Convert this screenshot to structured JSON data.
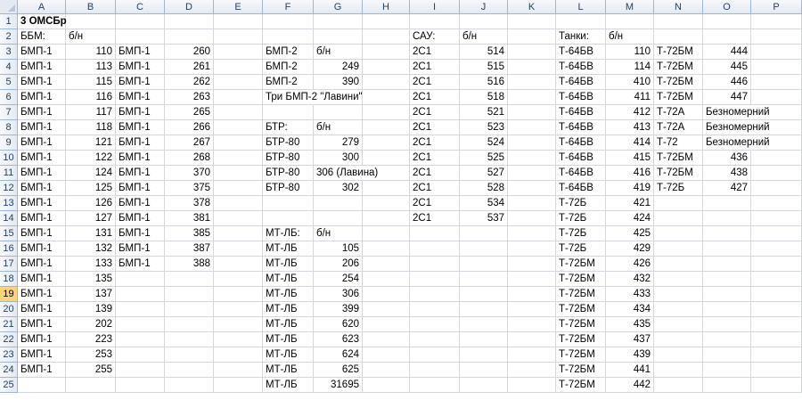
{
  "sheet": {
    "columns": [
      "A",
      "B",
      "C",
      "D",
      "E",
      "F",
      "G",
      "H",
      "I",
      "J",
      "K",
      "L",
      "M",
      "N",
      "O",
      "P"
    ],
    "rows": [
      "1",
      "2",
      "3",
      "4",
      "5",
      "6",
      "7",
      "8",
      "9",
      "10",
      "11",
      "12",
      "13",
      "14",
      "15",
      "16",
      "17",
      "18",
      "19",
      "20",
      "21",
      "22",
      "23",
      "24",
      "25"
    ],
    "selected_row": "19",
    "cells": [
      {
        "r": 1,
        "c": "A",
        "v": "3 ОМСБр",
        "bold": true
      },
      {
        "r": 2,
        "c": "A",
        "v": "ББМ:"
      },
      {
        "r": 2,
        "c": "B",
        "v": "б/н"
      },
      {
        "r": 2,
        "c": "I",
        "v": "САУ:"
      },
      {
        "r": 2,
        "c": "J",
        "v": "б/н"
      },
      {
        "r": 2,
        "c": "L",
        "v": "Танки:"
      },
      {
        "r": 2,
        "c": "M",
        "v": "б/н"
      },
      {
        "r": 3,
        "c": "A",
        "v": "БМП-1"
      },
      {
        "r": 3,
        "c": "B",
        "v": "110",
        "num": true
      },
      {
        "r": 3,
        "c": "C",
        "v": "БМП-1"
      },
      {
        "r": 3,
        "c": "D",
        "v": "260",
        "num": true
      },
      {
        "r": 3,
        "c": "F",
        "v": "БМП-2"
      },
      {
        "r": 3,
        "c": "G",
        "v": "б/н"
      },
      {
        "r": 3,
        "c": "I",
        "v": "2С1"
      },
      {
        "r": 3,
        "c": "J",
        "v": "514",
        "num": true
      },
      {
        "r": 3,
        "c": "L",
        "v": "Т-64БВ"
      },
      {
        "r": 3,
        "c": "M",
        "v": "110",
        "num": true
      },
      {
        "r": 3,
        "c": "N",
        "v": "Т-72БМ"
      },
      {
        "r": 3,
        "c": "O",
        "v": "444",
        "num": true
      },
      {
        "r": 4,
        "c": "A",
        "v": "БМП-1"
      },
      {
        "r": 4,
        "c": "B",
        "v": "113",
        "num": true
      },
      {
        "r": 4,
        "c": "C",
        "v": "БМП-1"
      },
      {
        "r": 4,
        "c": "D",
        "v": "261",
        "num": true
      },
      {
        "r": 4,
        "c": "F",
        "v": "БМП-2"
      },
      {
        "r": 4,
        "c": "G",
        "v": "249",
        "num": true
      },
      {
        "r": 4,
        "c": "I",
        "v": "2С1"
      },
      {
        "r": 4,
        "c": "J",
        "v": "515",
        "num": true
      },
      {
        "r": 4,
        "c": "L",
        "v": "Т-64БВ"
      },
      {
        "r": 4,
        "c": "M",
        "v": "114",
        "num": true
      },
      {
        "r": 4,
        "c": "N",
        "v": "Т-72БМ"
      },
      {
        "r": 4,
        "c": "O",
        "v": "445",
        "num": true
      },
      {
        "r": 5,
        "c": "A",
        "v": "БМП-1"
      },
      {
        "r": 5,
        "c": "B",
        "v": "115",
        "num": true
      },
      {
        "r": 5,
        "c": "C",
        "v": "БМП-1"
      },
      {
        "r": 5,
        "c": "D",
        "v": "262",
        "num": true
      },
      {
        "r": 5,
        "c": "F",
        "v": "БМП-2"
      },
      {
        "r": 5,
        "c": "G",
        "v": "390",
        "num": true
      },
      {
        "r": 5,
        "c": "I",
        "v": "2С1"
      },
      {
        "r": 5,
        "c": "J",
        "v": "516",
        "num": true
      },
      {
        "r": 5,
        "c": "L",
        "v": "Т-64БВ"
      },
      {
        "r": 5,
        "c": "M",
        "v": "410",
        "num": true
      },
      {
        "r": 5,
        "c": "N",
        "v": "Т-72БМ"
      },
      {
        "r": 5,
        "c": "O",
        "v": "446",
        "num": true
      },
      {
        "r": 6,
        "c": "A",
        "v": "БМП-1"
      },
      {
        "r": 6,
        "c": "B",
        "v": "116",
        "num": true
      },
      {
        "r": 6,
        "c": "C",
        "v": "БМП-1"
      },
      {
        "r": 6,
        "c": "D",
        "v": "263",
        "num": true
      },
      {
        "r": 6,
        "c": "F",
        "v": "Три БМП-2 \"Лавини\"",
        "over": true
      },
      {
        "r": 6,
        "c": "I",
        "v": "2С1"
      },
      {
        "r": 6,
        "c": "J",
        "v": "518",
        "num": true
      },
      {
        "r": 6,
        "c": "L",
        "v": "Т-64БВ"
      },
      {
        "r": 6,
        "c": "M",
        "v": "411",
        "num": true
      },
      {
        "r": 6,
        "c": "N",
        "v": "Т-72БМ"
      },
      {
        "r": 6,
        "c": "O",
        "v": "447",
        "num": true
      },
      {
        "r": 7,
        "c": "A",
        "v": "БМП-1"
      },
      {
        "r": 7,
        "c": "B",
        "v": "117",
        "num": true
      },
      {
        "r": 7,
        "c": "C",
        "v": "БМП-1"
      },
      {
        "r": 7,
        "c": "D",
        "v": "265",
        "num": true
      },
      {
        "r": 7,
        "c": "I",
        "v": "2С1"
      },
      {
        "r": 7,
        "c": "J",
        "v": "521",
        "num": true
      },
      {
        "r": 7,
        "c": "L",
        "v": "Т-64БВ"
      },
      {
        "r": 7,
        "c": "M",
        "v": "412",
        "num": true
      },
      {
        "r": 7,
        "c": "N",
        "v": "Т-72А"
      },
      {
        "r": 7,
        "c": "O",
        "v": "Безномерний",
        "over": true
      },
      {
        "r": 8,
        "c": "A",
        "v": "БМП-1"
      },
      {
        "r": 8,
        "c": "B",
        "v": "118",
        "num": true
      },
      {
        "r": 8,
        "c": "C",
        "v": "БМП-1"
      },
      {
        "r": 8,
        "c": "D",
        "v": "266",
        "num": true
      },
      {
        "r": 8,
        "c": "F",
        "v": "БТР:"
      },
      {
        "r": 8,
        "c": "G",
        "v": "б/н"
      },
      {
        "r": 8,
        "c": "I",
        "v": "2С1"
      },
      {
        "r": 8,
        "c": "J",
        "v": "523",
        "num": true
      },
      {
        "r": 8,
        "c": "L",
        "v": "Т-64БВ"
      },
      {
        "r": 8,
        "c": "M",
        "v": "413",
        "num": true
      },
      {
        "r": 8,
        "c": "N",
        "v": "Т-72А"
      },
      {
        "r": 8,
        "c": "O",
        "v": "Безномерний",
        "over": true
      },
      {
        "r": 9,
        "c": "A",
        "v": "БМП-1"
      },
      {
        "r": 9,
        "c": "B",
        "v": "121",
        "num": true
      },
      {
        "r": 9,
        "c": "C",
        "v": "БМП-1"
      },
      {
        "r": 9,
        "c": "D",
        "v": "267",
        "num": true
      },
      {
        "r": 9,
        "c": "F",
        "v": "БТР-80"
      },
      {
        "r": 9,
        "c": "G",
        "v": "279",
        "num": true
      },
      {
        "r": 9,
        "c": "I",
        "v": "2С1"
      },
      {
        "r": 9,
        "c": "J",
        "v": "524",
        "num": true
      },
      {
        "r": 9,
        "c": "L",
        "v": "Т-64БВ"
      },
      {
        "r": 9,
        "c": "M",
        "v": "414",
        "num": true
      },
      {
        "r": 9,
        "c": "N",
        "v": "Т-72"
      },
      {
        "r": 9,
        "c": "O",
        "v": "Безномерний",
        "over": true
      },
      {
        "r": 10,
        "c": "A",
        "v": "БМП-1"
      },
      {
        "r": 10,
        "c": "B",
        "v": "122",
        "num": true
      },
      {
        "r": 10,
        "c": "C",
        "v": "БМП-1"
      },
      {
        "r": 10,
        "c": "D",
        "v": "268",
        "num": true
      },
      {
        "r": 10,
        "c": "F",
        "v": "БТР-80"
      },
      {
        "r": 10,
        "c": "G",
        "v": "300",
        "num": true
      },
      {
        "r": 10,
        "c": "I",
        "v": "2С1"
      },
      {
        "r": 10,
        "c": "J",
        "v": "525",
        "num": true
      },
      {
        "r": 10,
        "c": "L",
        "v": "Т-64БВ"
      },
      {
        "r": 10,
        "c": "M",
        "v": "415",
        "num": true
      },
      {
        "r": 10,
        "c": "N",
        "v": "Т-72БМ"
      },
      {
        "r": 10,
        "c": "O",
        "v": "436",
        "num": true
      },
      {
        "r": 11,
        "c": "A",
        "v": "БМП-1"
      },
      {
        "r": 11,
        "c": "B",
        "v": "124",
        "num": true
      },
      {
        "r": 11,
        "c": "C",
        "v": "БМП-1"
      },
      {
        "r": 11,
        "c": "D",
        "v": "370",
        "num": true
      },
      {
        "r": 11,
        "c": "F",
        "v": "БТР-80"
      },
      {
        "r": 11,
        "c": "G",
        "v": "306 (Лавина)",
        "over": true
      },
      {
        "r": 11,
        "c": "I",
        "v": "2С1"
      },
      {
        "r": 11,
        "c": "J",
        "v": "527",
        "num": true
      },
      {
        "r": 11,
        "c": "L",
        "v": "Т-64БВ"
      },
      {
        "r": 11,
        "c": "M",
        "v": "416",
        "num": true
      },
      {
        "r": 11,
        "c": "N",
        "v": "Т-72БМ"
      },
      {
        "r": 11,
        "c": "O",
        "v": "438",
        "num": true
      },
      {
        "r": 12,
        "c": "A",
        "v": "БМП-1"
      },
      {
        "r": 12,
        "c": "B",
        "v": "125",
        "num": true
      },
      {
        "r": 12,
        "c": "C",
        "v": "БМП-1"
      },
      {
        "r": 12,
        "c": "D",
        "v": "375",
        "num": true
      },
      {
        "r": 12,
        "c": "F",
        "v": "БТР-80"
      },
      {
        "r": 12,
        "c": "G",
        "v": "302",
        "num": true
      },
      {
        "r": 12,
        "c": "I",
        "v": "2С1"
      },
      {
        "r": 12,
        "c": "J",
        "v": "528",
        "num": true
      },
      {
        "r": 12,
        "c": "L",
        "v": "Т-64БВ"
      },
      {
        "r": 12,
        "c": "M",
        "v": "419",
        "num": true
      },
      {
        "r": 12,
        "c": "N",
        "v": "Т-72Б"
      },
      {
        "r": 12,
        "c": "O",
        "v": "427",
        "num": true
      },
      {
        "r": 13,
        "c": "A",
        "v": "БМП-1"
      },
      {
        "r": 13,
        "c": "B",
        "v": "126",
        "num": true
      },
      {
        "r": 13,
        "c": "C",
        "v": "БМП-1"
      },
      {
        "r": 13,
        "c": "D",
        "v": "378",
        "num": true
      },
      {
        "r": 13,
        "c": "I",
        "v": "2С1"
      },
      {
        "r": 13,
        "c": "J",
        "v": "534",
        "num": true
      },
      {
        "r": 13,
        "c": "L",
        "v": "Т-72Б"
      },
      {
        "r": 13,
        "c": "M",
        "v": "421",
        "num": true
      },
      {
        "r": 14,
        "c": "A",
        "v": "БМП-1"
      },
      {
        "r": 14,
        "c": "B",
        "v": "127",
        "num": true
      },
      {
        "r": 14,
        "c": "C",
        "v": "БМП-1"
      },
      {
        "r": 14,
        "c": "D",
        "v": "381",
        "num": true
      },
      {
        "r": 14,
        "c": "I",
        "v": "2С1"
      },
      {
        "r": 14,
        "c": "J",
        "v": "537",
        "num": true
      },
      {
        "r": 14,
        "c": "L",
        "v": "Т-72Б"
      },
      {
        "r": 14,
        "c": "M",
        "v": "424",
        "num": true
      },
      {
        "r": 15,
        "c": "A",
        "v": "БМП-1"
      },
      {
        "r": 15,
        "c": "B",
        "v": "131",
        "num": true
      },
      {
        "r": 15,
        "c": "C",
        "v": "БМП-1"
      },
      {
        "r": 15,
        "c": "D",
        "v": "385",
        "num": true
      },
      {
        "r": 15,
        "c": "F",
        "v": "МТ-ЛБ:"
      },
      {
        "r": 15,
        "c": "G",
        "v": "б/н"
      },
      {
        "r": 15,
        "c": "L",
        "v": "Т-72Б"
      },
      {
        "r": 15,
        "c": "M",
        "v": "425",
        "num": true
      },
      {
        "r": 16,
        "c": "A",
        "v": "БМП-1"
      },
      {
        "r": 16,
        "c": "B",
        "v": "132",
        "num": true
      },
      {
        "r": 16,
        "c": "C",
        "v": "БМП-1"
      },
      {
        "r": 16,
        "c": "D",
        "v": "387",
        "num": true
      },
      {
        "r": 16,
        "c": "F",
        "v": "МТ-ЛБ"
      },
      {
        "r": 16,
        "c": "G",
        "v": "105",
        "num": true
      },
      {
        "r": 16,
        "c": "L",
        "v": "Т-72Б"
      },
      {
        "r": 16,
        "c": "M",
        "v": "429",
        "num": true
      },
      {
        "r": 17,
        "c": "A",
        "v": "БМП-1"
      },
      {
        "r": 17,
        "c": "B",
        "v": "133",
        "num": true
      },
      {
        "r": 17,
        "c": "C",
        "v": "БМП-1"
      },
      {
        "r": 17,
        "c": "D",
        "v": "388",
        "num": true
      },
      {
        "r": 17,
        "c": "F",
        "v": "МТ-ЛБ"
      },
      {
        "r": 17,
        "c": "G",
        "v": "206",
        "num": true
      },
      {
        "r": 17,
        "c": "L",
        "v": "Т-72БМ"
      },
      {
        "r": 17,
        "c": "M",
        "v": "426",
        "num": true
      },
      {
        "r": 18,
        "c": "A",
        "v": "БМП-1"
      },
      {
        "r": 18,
        "c": "B",
        "v": "135",
        "num": true
      },
      {
        "r": 18,
        "c": "F",
        "v": "МТ-ЛБ"
      },
      {
        "r": 18,
        "c": "G",
        "v": "254",
        "num": true
      },
      {
        "r": 18,
        "c": "L",
        "v": "Т-72БМ"
      },
      {
        "r": 18,
        "c": "M",
        "v": "432",
        "num": true
      },
      {
        "r": 19,
        "c": "A",
        "v": "БМП-1"
      },
      {
        "r": 19,
        "c": "B",
        "v": "137",
        "num": true
      },
      {
        "r": 19,
        "c": "F",
        "v": "МТ-ЛБ"
      },
      {
        "r": 19,
        "c": "G",
        "v": "306",
        "num": true
      },
      {
        "r": 19,
        "c": "L",
        "v": "Т-72БМ"
      },
      {
        "r": 19,
        "c": "M",
        "v": "433",
        "num": true
      },
      {
        "r": 20,
        "c": "A",
        "v": "БМП-1"
      },
      {
        "r": 20,
        "c": "B",
        "v": "139",
        "num": true
      },
      {
        "r": 20,
        "c": "F",
        "v": "МТ-ЛБ"
      },
      {
        "r": 20,
        "c": "G",
        "v": "399",
        "num": true
      },
      {
        "r": 20,
        "c": "L",
        "v": "Т-72БМ"
      },
      {
        "r": 20,
        "c": "M",
        "v": "434",
        "num": true
      },
      {
        "r": 21,
        "c": "A",
        "v": "БМП-1"
      },
      {
        "r": 21,
        "c": "B",
        "v": "202",
        "num": true
      },
      {
        "r": 21,
        "c": "F",
        "v": "МТ-ЛБ"
      },
      {
        "r": 21,
        "c": "G",
        "v": "620",
        "num": true
      },
      {
        "r": 21,
        "c": "L",
        "v": "Т-72БМ"
      },
      {
        "r": 21,
        "c": "M",
        "v": "435",
        "num": true
      },
      {
        "r": 22,
        "c": "A",
        "v": "БМП-1"
      },
      {
        "r": 22,
        "c": "B",
        "v": "223",
        "num": true
      },
      {
        "r": 22,
        "c": "F",
        "v": "МТ-ЛБ"
      },
      {
        "r": 22,
        "c": "G",
        "v": "623",
        "num": true
      },
      {
        "r": 22,
        "c": "L",
        "v": "Т-72БМ"
      },
      {
        "r": 22,
        "c": "M",
        "v": "437",
        "num": true
      },
      {
        "r": 23,
        "c": "A",
        "v": "БМП-1"
      },
      {
        "r": 23,
        "c": "B",
        "v": "253",
        "num": true
      },
      {
        "r": 23,
        "c": "F",
        "v": "МТ-ЛБ"
      },
      {
        "r": 23,
        "c": "G",
        "v": "624",
        "num": true
      },
      {
        "r": 23,
        "c": "L",
        "v": "Т-72БМ"
      },
      {
        "r": 23,
        "c": "M",
        "v": "439",
        "num": true
      },
      {
        "r": 24,
        "c": "A",
        "v": "БМП-1"
      },
      {
        "r": 24,
        "c": "B",
        "v": "255",
        "num": true
      },
      {
        "r": 24,
        "c": "F",
        "v": "МТ-ЛБ"
      },
      {
        "r": 24,
        "c": "G",
        "v": "625",
        "num": true
      },
      {
        "r": 24,
        "c": "L",
        "v": "Т-72БМ"
      },
      {
        "r": 24,
        "c": "M",
        "v": "441",
        "num": true
      },
      {
        "r": 25,
        "c": "F",
        "v": "МТ-ЛБ"
      },
      {
        "r": 25,
        "c": "G",
        "v": "31695",
        "num": true
      },
      {
        "r": 25,
        "c": "L",
        "v": "Т-72БМ"
      },
      {
        "r": 25,
        "c": "M",
        "v": "442",
        "num": true
      }
    ]
  }
}
